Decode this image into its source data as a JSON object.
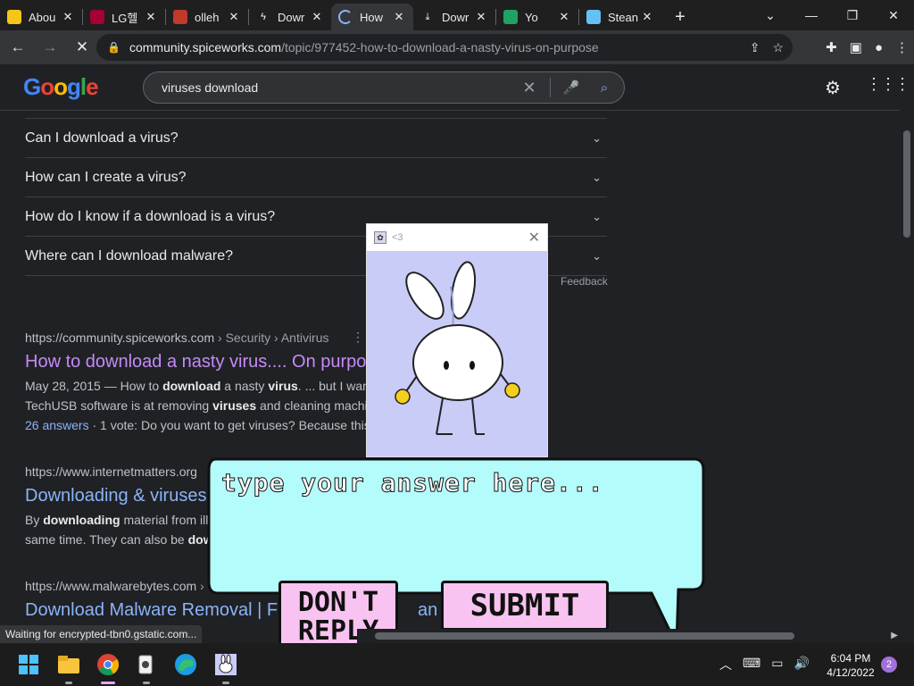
{
  "tabs": [
    {
      "label": "Abou",
      "icon": "smiley-icon",
      "color": "#f5c518"
    },
    {
      "label": "LG헬",
      "icon": "lg-icon",
      "color": "#a50034"
    },
    {
      "label": "olleh",
      "icon": "gamepad-icon",
      "color": "#c0392b"
    },
    {
      "label": "Dowr",
      "icon": "bolt-icon",
      "color": "#ffffff"
    },
    {
      "label": "How",
      "icon": "loading-icon",
      "color": "#8ab4f8"
    },
    {
      "label": "Dowr",
      "icon": "download-icon",
      "color": "#ffffff"
    },
    {
      "label": "Yo",
      "icon": "check-icon",
      "color": "#1ea362"
    },
    {
      "label": "Stean",
      "icon": "steam-icon",
      "color": "#66c0f4"
    }
  ],
  "url": {
    "domain": "community.spiceworks.com",
    "path": "/topic/977452-how-to-download-a-nasty-virus-on-purpose"
  },
  "search": {
    "query": "viruses download"
  },
  "paa": [
    "Can I download a virus?",
    "How can I create a virus?",
    "How do I know if a download is a virus?",
    "Where can I download malware?"
  ],
  "feedback": "Feedback",
  "results": [
    {
      "cite": "https://community.spiceworks.com",
      "path": " › Security › Antivirus",
      "title": "How to download a nasty virus.... On purpo",
      "line1_pre": "May 28, 2015 — How to ",
      "line1_b1": "download",
      "line1_mid": " a nasty ",
      "line1_b2": "virus",
      "line1_post": ". ... but I want t",
      "line2_pre": "TechUSB software is at removing ",
      "line2_b": "viruses",
      "line2_post": " and cleaning machi",
      "answers": "26 answers",
      "line3_post": " · 1 vote: Do you want to get viruses? Because this"
    },
    {
      "cite": "https://www.internetmatters.org",
      "title": "Downloading & viruses",
      "line1_pre": "By ",
      "line1_b": "downloading",
      "line1_post": " material from ille",
      "line2_pre": "same time. They can also be ",
      "line2_b": "dow"
    },
    {
      "cite": "https://www.malwarebytes.com",
      "path": " › ",
      "title": "Download Malware Removal | Fr",
      "title_tail": "an &"
    }
  ],
  "popup": {
    "title": "<3"
  },
  "dialog": {
    "placeholder": "type your answer here...",
    "noreply": "DON'T REPLY",
    "submit": "SUBMIT"
  },
  "status": "Waiting for encrypted-tbn0.gstatic.com...",
  "clock": {
    "time": "6:04 PM",
    "date": "4/12/2022"
  },
  "notifications": "2"
}
